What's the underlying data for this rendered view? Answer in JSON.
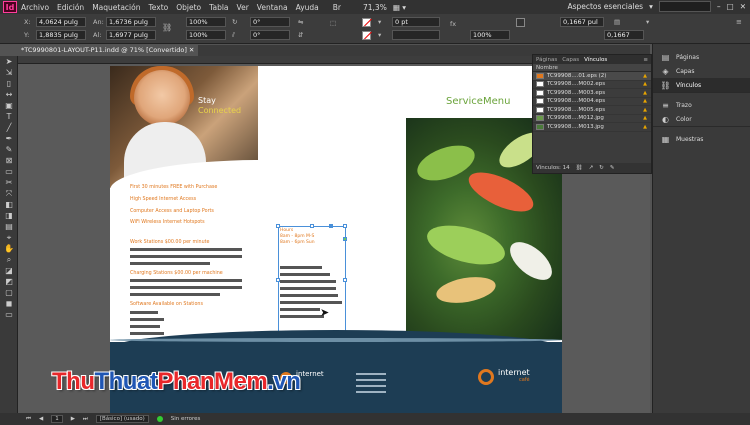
{
  "app": {
    "logo": "Id",
    "zoom": "71,3%",
    "workspace": "Aspectos esenciales"
  },
  "menu": [
    "Archivo",
    "Edición",
    "Maquetación",
    "Texto",
    "Objeto",
    "Tabla",
    "Ver",
    "Ventana",
    "Ayuda"
  ],
  "control": {
    "x_label": "X:",
    "x": "4,0624 pulg",
    "y_label": "Y:",
    "y": "1,8835 pulg",
    "w_label": "An:",
    "w": "1,6736 pulg",
    "h_label": "Al:",
    "h": "1,6977 pulg",
    "scale_x": "100%",
    "scale_y": "100%",
    "rotate": "0°",
    "shear": "0°",
    "stroke_weight": "0 pt",
    "ref_size": "100%",
    "inset_1": "0,1667 pul",
    "inset_2": "0,1667"
  },
  "document": {
    "tab": "*TC9990801-LAYOUT-P11.indd @ 71% [Convertido]"
  },
  "left_page": {
    "stay": "Stay",
    "connected": "Connected",
    "features": [
      "First 30 minutes FREE with Purchase",
      "High Speed Internet Access",
      "Computer Access and Laptop Ports",
      "WiFi Wireless Internet Hotspots"
    ],
    "work": "Work Stations  $00.00 per minute",
    "charging": "Charging Stations  $00.00 per machine",
    "software": "Software Available on Stations",
    "frame_text": [
      "Hours",
      "8am - 8pm M-S",
      "8am - 6pm Sun"
    ]
  },
  "right_page": {
    "title": "ServiceMenu"
  },
  "band": {
    "logo_text": "internet",
    "logo_sub": "café"
  },
  "links_panel": {
    "tabs": [
      "Páginas",
      "Capas",
      "Vínculos"
    ],
    "active_tab": "Vínculos",
    "header": "Nombre",
    "rows": [
      {
        "name": "TC99908....01.eps (2)"
      },
      {
        "name": "TC99908....M002.eps"
      },
      {
        "name": "TC99908....M003.eps"
      },
      {
        "name": "TC99908....M004.eps"
      },
      {
        "name": "TC99908....M005.eps"
      },
      {
        "name": "TC99908....M012.jpg"
      },
      {
        "name": "TC99908....M013.jpg"
      }
    ],
    "footer": "Vínculos: 14"
  },
  "right_panel": [
    {
      "label": "Páginas",
      "icon": "pages-icon"
    },
    {
      "label": "Capas",
      "icon": "layers-icon"
    },
    {
      "label": "Vínculos",
      "icon": "links-icon"
    },
    {
      "label": "Trazo",
      "icon": "stroke-icon"
    },
    {
      "label": "Color",
      "icon": "color-icon"
    },
    {
      "label": "Muestras",
      "icon": "swatches-icon"
    }
  ],
  "status": {
    "page": "1",
    "style": "[Básico] (usado)",
    "errors": "Sin errores"
  },
  "watermark": {
    "part1": "Thu",
    "part2": "Thuat",
    "part3": "PhanMem",
    "part4": ".vn"
  }
}
